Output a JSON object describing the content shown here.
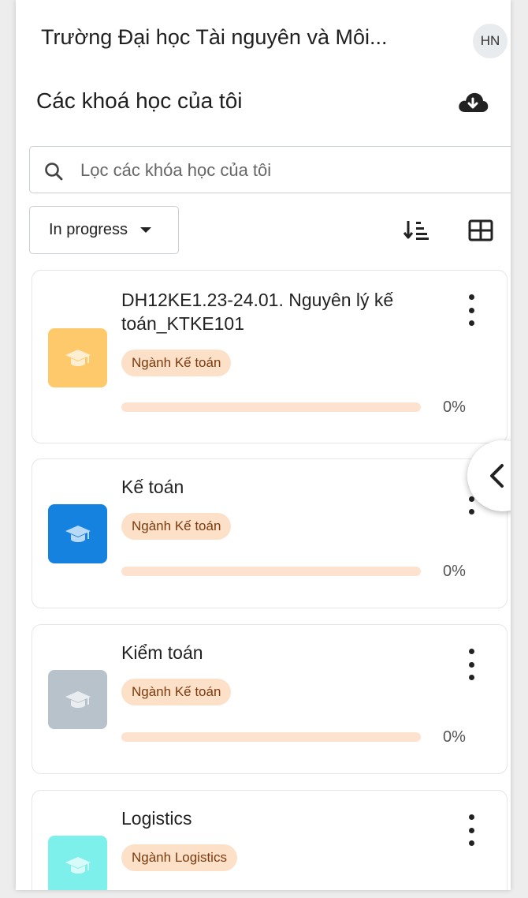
{
  "header": {
    "site_name": "Trường Đại học Tài nguyên và Môi...",
    "user_initials": "HN"
  },
  "main": {
    "title": "Các khoá học của tôi",
    "search_placeholder": "Lọc các khóa học của tôi",
    "filter_label": "In progress"
  },
  "courses": [
    {
      "name": "DH12KE1.23-24.01. Nguyên lý kế toán_KTKE101",
      "category": "Ngành Kế toán",
      "progress": 0,
      "progress_label": "0%",
      "image_color": "#fdc96a"
    },
    {
      "name": "Kế toán",
      "category": "Ngành Kế toán",
      "progress": 0,
      "progress_label": "0%",
      "image_color": "#1682e0"
    },
    {
      "name": "Kiểm toán",
      "category": "Ngành Kế toán",
      "progress": 0,
      "progress_label": "0%",
      "image_color": "#b8c2cb"
    },
    {
      "name": "Logistics",
      "category": "Ngành Logistics",
      "progress": null,
      "progress_label": null,
      "image_color": "#7ef0ec"
    }
  ],
  "icons": {
    "download": "cloud-download-icon",
    "search": "search-icon",
    "sort": "sort-icon",
    "view": "grid-view-icon",
    "course_image": "graduation-cap-icon",
    "menu": "kebab-menu-icon",
    "drawer": "chevron-left-icon"
  },
  "colors": {
    "badge_bg": "#fde0c8",
    "badge_text": "#7a3b0e",
    "progress_track": "#fde3cf"
  }
}
